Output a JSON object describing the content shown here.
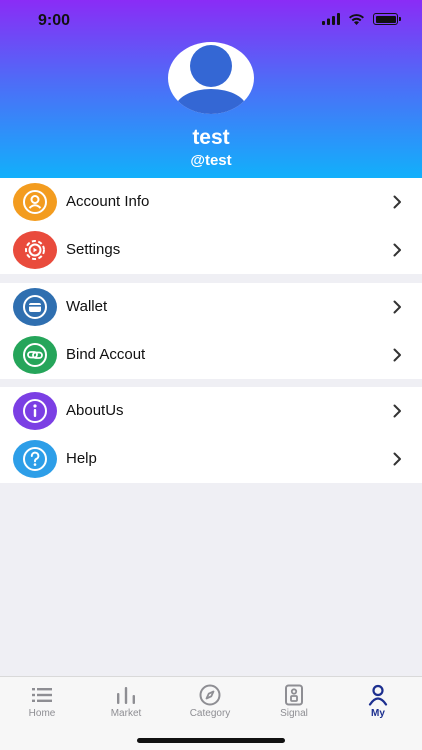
{
  "status_bar": {
    "time": "9:00"
  },
  "profile": {
    "name": "test",
    "handle": "@test"
  },
  "groups": [
    [
      {
        "label": "Account Info",
        "icon": "account-icon",
        "color": "#f39c1f"
      },
      {
        "label": "Settings",
        "icon": "settings-icon",
        "color": "#e94b3c"
      }
    ],
    [
      {
        "label": "Wallet",
        "icon": "wallet-icon",
        "color": "#2f6fb0"
      },
      {
        "label": "Bind Accout",
        "icon": "link-icon",
        "color": "#25a55a"
      }
    ],
    [
      {
        "label": "AboutUs",
        "icon": "info-icon",
        "color": "#7b3fe4"
      },
      {
        "label": "Help",
        "icon": "help-icon",
        "color": "#2d9ee8"
      }
    ]
  ],
  "tabbar": {
    "active": "My",
    "active_color": "#1c2f8f",
    "tabs": [
      {
        "label": "Home",
        "icon": "list-icon"
      },
      {
        "label": "Market",
        "icon": "bars-icon"
      },
      {
        "label": "Category",
        "icon": "compass-icon"
      },
      {
        "label": "Signal",
        "icon": "signal-icon"
      },
      {
        "label": "My",
        "icon": "person-icon"
      }
    ]
  }
}
